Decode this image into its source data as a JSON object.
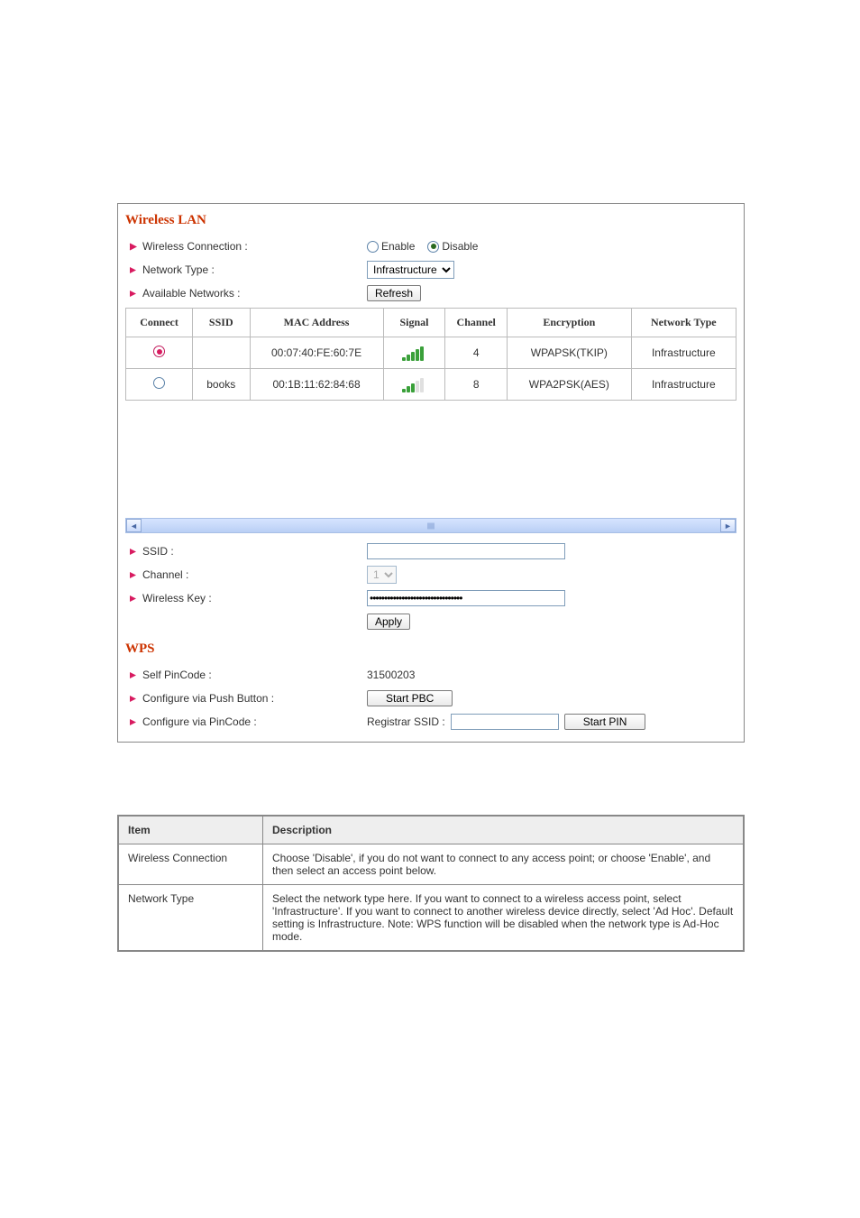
{
  "section_title": "Wireless LAN",
  "labels": {
    "wireless_connection": "Wireless Connection :",
    "network_type": "Network Type :",
    "available_networks": "Available Networks :",
    "ssid": "SSID :",
    "channel": "Channel :",
    "wireless_key": "Wireless Key :",
    "enable": "Enable",
    "disable": "Disable",
    "refresh": "Refresh",
    "apply": "Apply"
  },
  "wireless_connection_value": "disable",
  "network_type_value": "Infrastructure",
  "columns": {
    "connect": "Connect",
    "ssid": "SSID",
    "mac": "MAC Address",
    "signal": "Signal",
    "channel": "Channel",
    "encryption": "Encryption",
    "ntype": "Network Type"
  },
  "networks": [
    {
      "selected": true,
      "ssid": "",
      "mac": "00:07:40:FE:60:7E",
      "signal_bars": 5,
      "channel": "4",
      "encryption": "WPAPSK(TKIP)",
      "ntype": "Infrastructure"
    },
    {
      "selected": false,
      "ssid": "books",
      "mac": "00:1B:11:62:84:68",
      "signal_bars": 3,
      "channel": "8",
      "encryption": "WPA2PSK(AES)",
      "ntype": "Infrastructure"
    }
  ],
  "form": {
    "ssid_value": "",
    "channel_value": "1",
    "key_value_masked": "●●●●●●●●●●●●●●●●●●●●●●●●●●●●●●●●"
  },
  "wps": {
    "title": "WPS",
    "labels": {
      "self_pincode": "Self PinCode :",
      "push_button": "Configure via Push Button :",
      "pincode": "Configure via PinCode :",
      "registrar_ssid": "Registrar SSID :",
      "start_pbc": "Start PBC",
      "start_pin": "Start PIN"
    },
    "self_pincode_value": "31500203",
    "registrar_ssid_value": ""
  },
  "desc": {
    "header_item": "Item",
    "header_desc": "Description",
    "rows": [
      {
        "item": "Wireless Connection",
        "desc": "Choose 'Disable', if you do not want to connect to any access point; or choose 'Enable', and then select an access point below."
      },
      {
        "item": "Network Type",
        "desc": "Select the network type here. If you want to connect to a wireless access point, select 'Infrastructure'. If you want to connect to another wireless device directly, select 'Ad Hoc'. Default setting is Infrastructure. Note: WPS function will be disabled when the network type is Ad-Hoc mode."
      }
    ]
  }
}
